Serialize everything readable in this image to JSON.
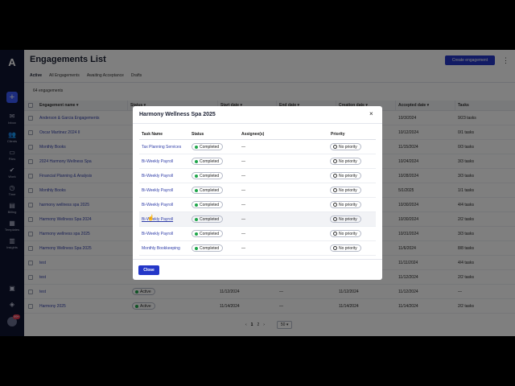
{
  "sidebar": {
    "logo": "A",
    "items": [
      {
        "icon": "inbox-icon",
        "label": "Inbox"
      },
      {
        "icon": "clients-icon",
        "label": "Clients"
      },
      {
        "icon": "files-icon",
        "label": "Files"
      },
      {
        "icon": "work-icon",
        "label": "Work"
      },
      {
        "icon": "time-icon",
        "label": "Time"
      },
      {
        "icon": "billing-icon",
        "label": "Billing"
      },
      {
        "icon": "templates-icon",
        "label": "Templates"
      },
      {
        "icon": "insights-icon",
        "label": "Insights"
      }
    ],
    "badge": "99+"
  },
  "header": {
    "title": "Engagements List",
    "create_label": "Create engagement",
    "more": "⋮"
  },
  "tabs": [
    "Active",
    "All Engagements",
    "Awaiting Acceptance",
    "Drafts"
  ],
  "count_text": "64 engagements",
  "table": {
    "columns": [
      "Engagement name",
      "Status",
      "Start date",
      "End date",
      "Creation date",
      "Accepted date",
      "Tasks"
    ],
    "rows": [
      {
        "name": "Anderson & Garcia Engagements",
        "status": "",
        "start": "",
        "end": "",
        "created": "",
        "accepted": "10/3/2024",
        "tasks": "9/23 tasks"
      },
      {
        "name": "Oscar Martinez 2024 II",
        "status": "",
        "start": "",
        "end": "",
        "created": "",
        "accepted": "10/12/2024",
        "tasks": "0/1 tasks"
      },
      {
        "name": "Monthly Books",
        "status": "",
        "start": "",
        "end": "",
        "created": "",
        "accepted": "11/15/2024",
        "tasks": "0/3 tasks"
      },
      {
        "name": "2024 Harmony Wellness Spa",
        "status": "",
        "start": "",
        "end": "",
        "created": "",
        "accepted": "10/24/2024",
        "tasks": "3/3 tasks"
      },
      {
        "name": "Financial Planning & Analysis",
        "status": "",
        "start": "",
        "end": "",
        "created": "",
        "accepted": "10/28/2024",
        "tasks": "3/3 tasks"
      },
      {
        "name": "Monthly Books",
        "status": "",
        "start": "",
        "end": "",
        "created": "",
        "accepted": "5/1/2025",
        "tasks": "1/1 tasks"
      },
      {
        "name": "harmony wellness spa 2025",
        "status": "",
        "start": "",
        "end": "",
        "created": "",
        "accepted": "10/30/2024",
        "tasks": "4/4 tasks"
      },
      {
        "name": "Harmony Wellness Spa 2024",
        "status": "",
        "start": "",
        "end": "",
        "created": "",
        "accepted": "10/30/2024",
        "tasks": "2/2 tasks"
      },
      {
        "name": "Harmony wellness spa 2025",
        "status": "",
        "start": "",
        "end": "",
        "created": "",
        "accepted": "10/31/2024",
        "tasks": "3/3 tasks"
      },
      {
        "name": "Harmony Wellness Spa 2025",
        "status": "",
        "start": "",
        "end": "",
        "created": "",
        "accepted": "11/6/2024",
        "tasks": "8/8 tasks"
      },
      {
        "name": "test",
        "status": "",
        "start": "",
        "end": "",
        "created": "",
        "accepted": "11/11/2024",
        "tasks": "4/4 tasks"
      },
      {
        "name": "test",
        "status": "",
        "start": "",
        "end": "",
        "created": "",
        "accepted": "11/12/2024",
        "tasks": "2/2 tasks"
      },
      {
        "name": "test",
        "status": "Active",
        "start": "11/12/2024",
        "end": "—",
        "created": "11/12/2024",
        "accepted": "11/12/2024",
        "tasks": "—"
      },
      {
        "name": "Harmony 2025",
        "status": "Active",
        "start": "11/14/2024",
        "end": "—",
        "created": "11/14/2024",
        "accepted": "11/14/2024",
        "tasks": "2/2 tasks"
      }
    ]
  },
  "pager": {
    "prev": "‹",
    "pages": [
      "1",
      "2"
    ],
    "next": "›",
    "per_page": "50 ▾"
  },
  "modal": {
    "title": "Harmony Wellness Spa 2025",
    "close_icon": "×",
    "columns": [
      "Task Name",
      "Status",
      "Assignee(s)",
      "Priority"
    ],
    "rows": [
      {
        "task": "Tax Planning Services",
        "status": "Completed",
        "assignee": "—",
        "priority": "No priority"
      },
      {
        "task": "Bi-Weekly Payroll",
        "status": "Completed",
        "assignee": "—",
        "priority": "No priority"
      },
      {
        "task": "Bi-Weekly Payroll",
        "status": "Completed",
        "assignee": "—",
        "priority": "No priority"
      },
      {
        "task": "Bi-Weekly Payroll",
        "status": "Completed",
        "assignee": "—",
        "priority": "No priority"
      },
      {
        "task": "Bi-Weekly Payroll",
        "status": "Completed",
        "assignee": "—",
        "priority": "No priority"
      },
      {
        "task": "Bi-Weekly Payroll",
        "status": "Completed",
        "assignee": "—",
        "priority": "No priority"
      },
      {
        "task": "Bi-Weekly Payroll",
        "status": "Completed",
        "assignee": "—",
        "priority": "No priority"
      },
      {
        "task": "Monthly Bookkeeping",
        "status": "Completed",
        "assignee": "—",
        "priority": "No priority"
      }
    ],
    "close_label": "Close"
  },
  "colors": {
    "accent": "#2437c8",
    "rail": "#0f1530",
    "completed": "#1fa64a",
    "link": "#2f3da8"
  }
}
